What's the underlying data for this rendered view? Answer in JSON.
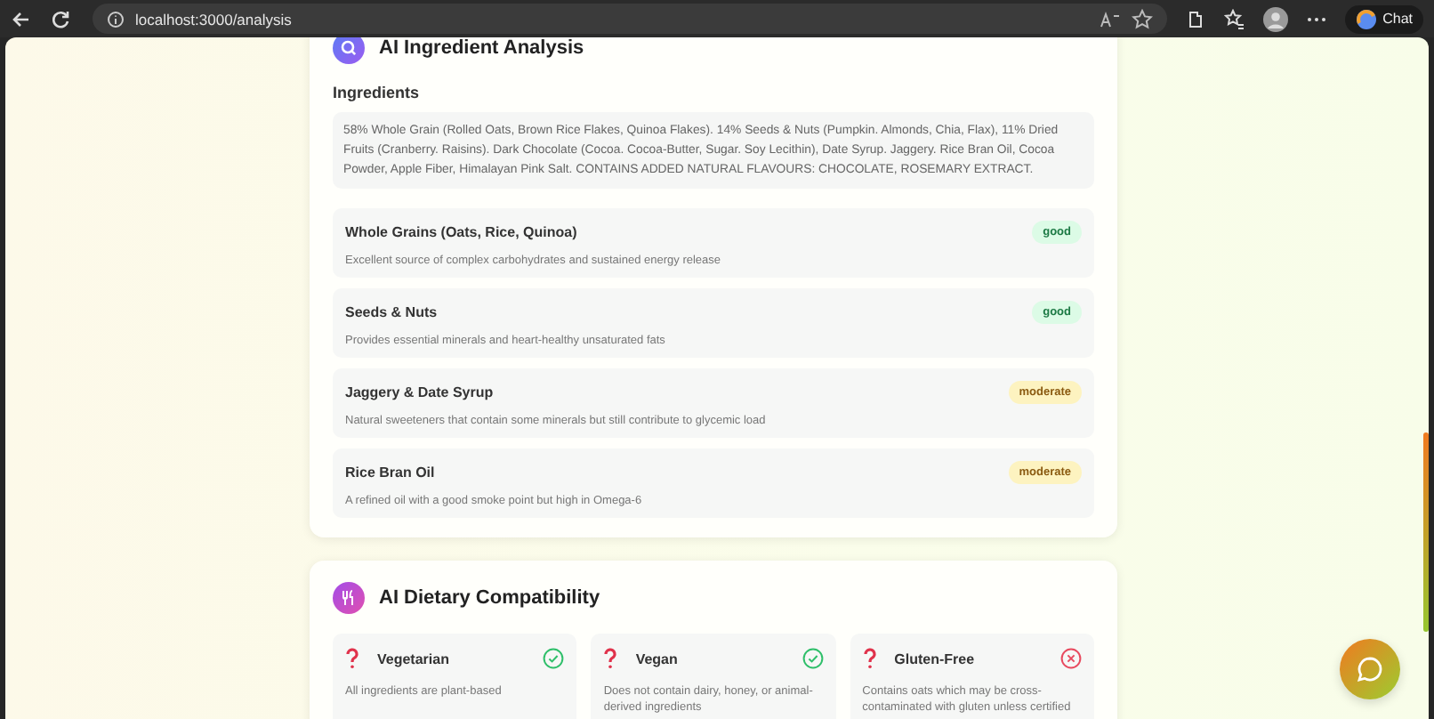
{
  "browser": {
    "url": "localhost:3000/analysis",
    "chat_label": "Chat"
  },
  "analysis": {
    "title": "AI Ingredient Analysis",
    "ingredients_label": "Ingredients",
    "ingredients_text": "58% Whole Grain (Rolled Oats, Brown Rice Flakes, Quinoa Flakes). 14% Seeds & Nuts (Pumpkin. Almonds, Chia, Flax), 11% Dried Fruits (Cranberry. Raisins). Dark Chocolate (Cocoa. Cocoa-Butter, Sugar. Soy Lecithin), Date Syrup. Jaggery. Rice Bran Oil, Cocoa Powder, Apple Fiber, Himalayan Pink Salt. CONTAINS ADDED NATURAL FLAVOURS: CHOCOLATE, ROSEMARY EXTRACT.",
    "items": [
      {
        "name": "Whole Grains (Oats, Rice, Quinoa)",
        "rating": "good",
        "description": "Excellent source of complex carbohydrates and sustained energy release"
      },
      {
        "name": "Seeds & Nuts",
        "rating": "good",
        "description": "Provides essential minerals and heart-healthy unsaturated fats"
      },
      {
        "name": "Jaggery & Date Syrup",
        "rating": "moderate",
        "description": "Natural sweeteners that contain some minerals but still contribute to glycemic load"
      },
      {
        "name": "Rice Bran Oil",
        "rating": "moderate",
        "description": "A refined oil with a good smoke point but high in Omega-6"
      }
    ]
  },
  "dietary": {
    "title": "AI Dietary Compatibility",
    "items": [
      {
        "name": "Vegetarian",
        "compatible": true,
        "description": "All ingredients are plant-based"
      },
      {
        "name": "Vegan",
        "compatible": true,
        "description": "Does not contain dairy, honey, or animal-derived ingredients"
      },
      {
        "name": "Gluten-Free",
        "compatible": false,
        "description": "Contains oats which may be cross-contaminated with gluten unless certified"
      }
    ]
  }
}
